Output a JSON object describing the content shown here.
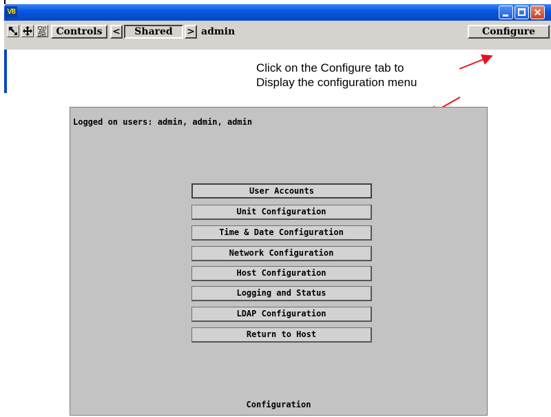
{
  "titlebar": {
    "app_icon": "V8",
    "buttons": [
      "minimize-icon",
      "maximize-icon",
      "close-icon"
    ]
  },
  "toolbar": {
    "icons": [
      "resize-arrow-icon",
      "move-icon",
      "ctrl-alt-del-icon"
    ],
    "ctrl_alt_del_text": "Ctrl Alt Del",
    "controls_label": "Controls",
    "prev_label": "<",
    "shared_label": "Shared",
    "next_label": ">",
    "user_label": "admin",
    "configure_label": "Configure"
  },
  "annotation": {
    "line1": "Click on the Configure tab to",
    "line2": "Display the configuration menu",
    "arrow_color": "#e8101a"
  },
  "panel": {
    "logged_users": "Logged on users: admin, admin, admin",
    "buttons": [
      "User Accounts",
      "Unit Configuration",
      "Time & Date Configuration",
      "Network Configuration",
      "Host Configuration",
      "Logging and Status",
      "LDAP Configuration",
      "Return to Host"
    ],
    "footer": "Configuration"
  }
}
